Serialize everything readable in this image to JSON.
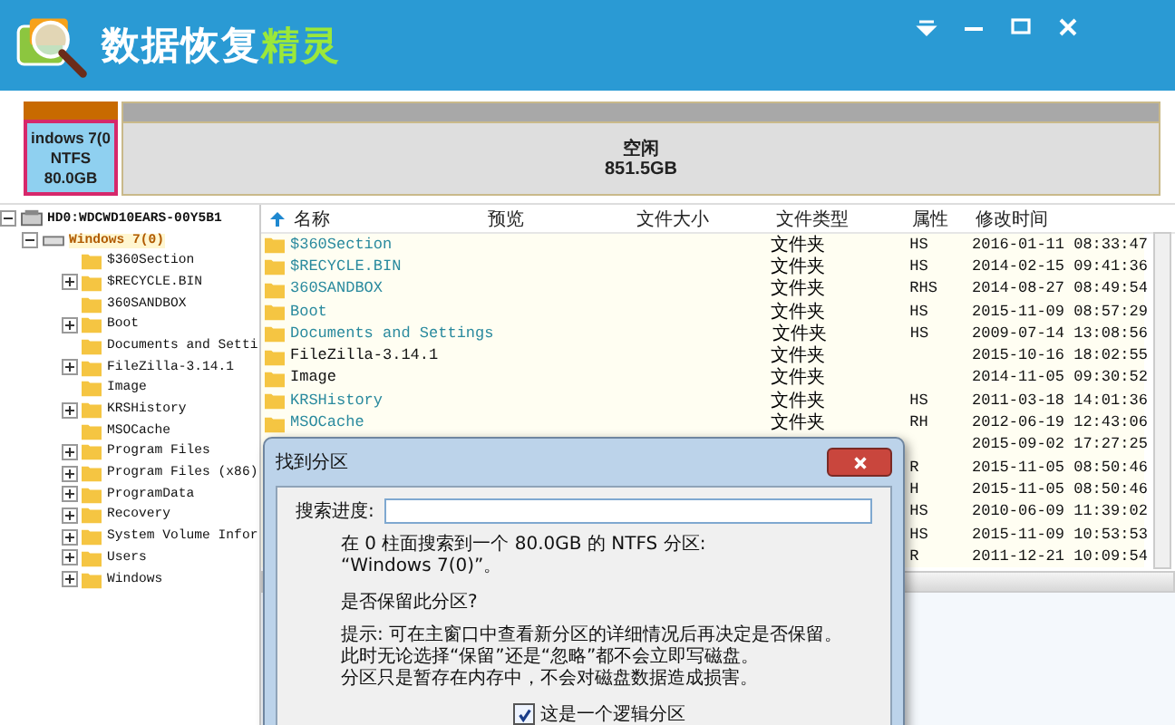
{
  "app": {
    "title_main": "数据恢复",
    "title_accent": "精灵"
  },
  "partitions": [
    {
      "name": "indows 7(0",
      "fs": "NTFS",
      "size": "80.0GB",
      "kind": "used",
      "selected": true
    },
    {
      "name": "空闲",
      "size": "851.5GB",
      "kind": "free",
      "selected": false
    }
  ],
  "tree": [
    {
      "label": "HD0:WDCWD10EARS-00Y5B1",
      "kind": "disk",
      "expanded": true,
      "children": [
        {
          "label": "Windows 7(0)",
          "kind": "partition",
          "expanded": true,
          "selected": true,
          "children": [
            {
              "label": "$360Section",
              "expandable": false
            },
            {
              "label": "$RECYCLE.BIN",
              "expandable": true
            },
            {
              "label": "360SANDBOX",
              "expandable": false
            },
            {
              "label": "Boot",
              "expandable": true
            },
            {
              "label": "Documents and Setti",
              "expandable": false
            },
            {
              "label": "FileZilla-3.14.1",
              "expandable": true
            },
            {
              "label": "Image",
              "expandable": false
            },
            {
              "label": "KRSHistory",
              "expandable": true
            },
            {
              "label": "MSOCache",
              "expandable": false
            },
            {
              "label": "Program Files",
              "expandable": true
            },
            {
              "label": "Program Files (x86)",
              "expandable": true
            },
            {
              "label": "ProgramData",
              "expandable": true
            },
            {
              "label": "Recovery",
              "expandable": true
            },
            {
              "label": "System Volume Infor",
              "expandable": true
            },
            {
              "label": "Users",
              "expandable": true
            },
            {
              "label": "Windows",
              "expandable": true
            }
          ]
        }
      ]
    }
  ],
  "table": {
    "columns": [
      "名称",
      "预览",
      "文件大小",
      "文件类型",
      "属性",
      "修改时间"
    ],
    "rows": [
      {
        "name": "$360Section",
        "hidden": true,
        "type": "文件夹",
        "attributes": "HS",
        "modified": "2016-01-11 08:33:47"
      },
      {
        "name": "$RECYCLE.BIN",
        "hidden": true,
        "type": "文件夹",
        "attributes": "HS",
        "modified": "2014-02-15 09:41:36"
      },
      {
        "name": "360SANDBOX",
        "hidden": true,
        "type": "文件夹",
        "attributes": "RHS",
        "modified": "2014-08-27 08:49:54"
      },
      {
        "name": "Boot",
        "hidden": true,
        "type": "文件夹",
        "attributes": "HS",
        "modified": "2015-11-09 08:57:29"
      },
      {
        "name": "Documents and Settings",
        "hidden": true,
        "type": "文件夹",
        "attributes": "HS",
        "modified": "2009-07-14 13:08:56"
      },
      {
        "name": "FileZilla-3.14.1",
        "hidden": false,
        "type": "文件夹",
        "modified": "2015-10-16 18:02:55"
      },
      {
        "name": "Image",
        "hidden": false,
        "type": "文件夹",
        "modified": "2014-11-05 09:30:52"
      },
      {
        "name": "KRSHistory",
        "hidden": true,
        "type": "文件夹",
        "attributes": "HS",
        "modified": "2011-03-18 14:01:36"
      },
      {
        "name": "MSOCache",
        "hidden": true,
        "type": "文件夹",
        "attributes": "RH",
        "modified": "2012-06-19 12:43:06"
      },
      {
        "modified": "2015-09-02 17:27:25"
      },
      {
        "attributes": "R",
        "modified": "2015-11-05 08:50:46"
      },
      {
        "attributes": "H",
        "modified": "2015-11-05 08:50:46"
      },
      {
        "attributes": "HS",
        "modified": "2010-06-09 11:39:02"
      },
      {
        "attributes": "HS",
        "modified": "2015-11-09 10:53:53"
      },
      {
        "attributes": "R",
        "modified": "2011-12-21 10:09:54"
      }
    ]
  },
  "dialog": {
    "title": "找到分区",
    "progress_label": "搜索进度:",
    "message": [
      "在 0 柱面搜索到一个 80.0GB 的 NTFS 分区:",
      "“Windows 7(0)”。"
    ],
    "question": "是否保留此分区?",
    "tips": [
      "提示: 可在主窗口中查看新分区的详细情况后再决定是否保留。",
      "此时无论选择“保留”还是“忽略”都不会立即写磁盘。",
      "分区只是暂存在内存中，不会对磁盘数据造成损害。"
    ],
    "checkbox": {
      "label": "这是一个逻辑分区",
      "checked": true
    }
  }
}
